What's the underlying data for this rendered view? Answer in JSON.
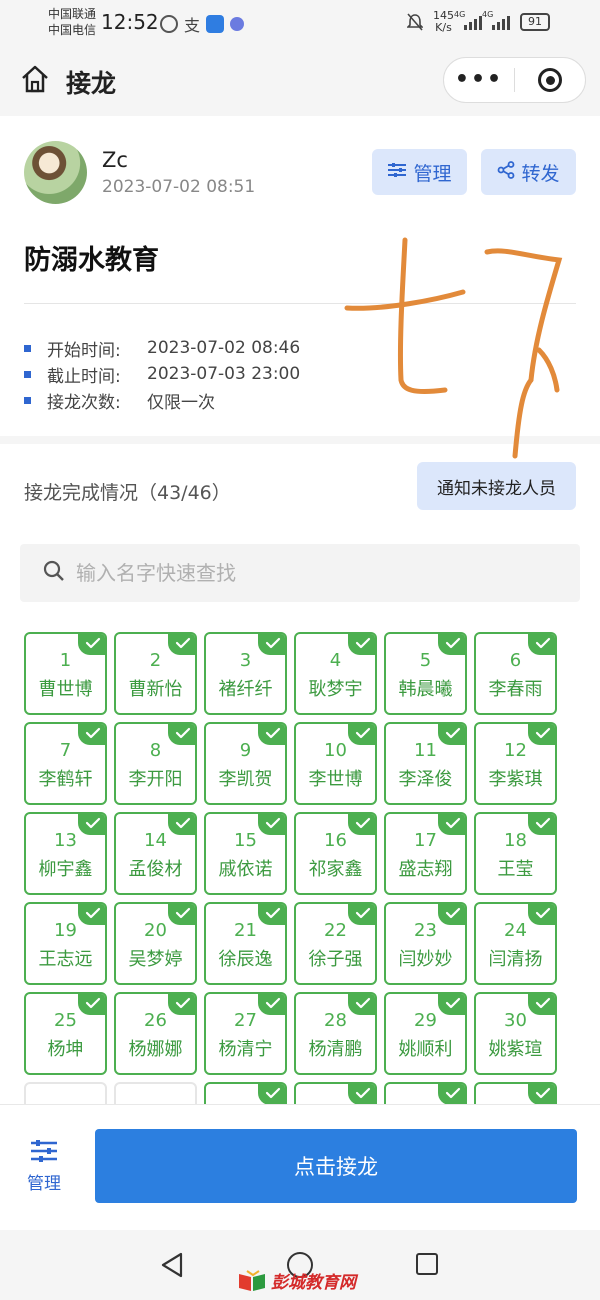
{
  "status_bar": {
    "carrier1": "中国联通",
    "carrier2": "中国电信",
    "time": "12:52",
    "speed_value": "145",
    "speed_unit": "K/s",
    "net1": "4G",
    "net2": "4G",
    "battery": "91"
  },
  "title_bar": {
    "title": "接龙",
    "more_label": "•••"
  },
  "post": {
    "author": "Zc",
    "date": "2023-07-02 08:51",
    "manage_label": "管理",
    "share_label": "转发",
    "title": "防溺水教育",
    "meta": [
      {
        "label": "开始时间:",
        "value": "2023-07-02 08:46"
      },
      {
        "label": "截止时间:",
        "value": "2023-07-03 23:00"
      },
      {
        "label": "接龙次数:",
        "value": "仅限一次"
      }
    ]
  },
  "progress": {
    "title": "接龙完成情况（43/46）",
    "notify_label": "通知未接龙人员",
    "search_placeholder": "输入名字快速查找",
    "entries": [
      {
        "num": "1",
        "name": "曹世博"
      },
      {
        "num": "2",
        "name": "曹新怡"
      },
      {
        "num": "3",
        "name": "褚纤纤"
      },
      {
        "num": "4",
        "name": "耿梦宇"
      },
      {
        "num": "5",
        "name": "韩晨曦"
      },
      {
        "num": "6",
        "name": "李春雨"
      },
      {
        "num": "7",
        "name": "李鹤轩"
      },
      {
        "num": "8",
        "name": "李开阳"
      },
      {
        "num": "9",
        "name": "李凯贺"
      },
      {
        "num": "10",
        "name": "李世博"
      },
      {
        "num": "11",
        "name": "李泽俊"
      },
      {
        "num": "12",
        "name": "李紫琪"
      },
      {
        "num": "13",
        "name": "柳宇鑫"
      },
      {
        "num": "14",
        "name": "孟俊材"
      },
      {
        "num": "15",
        "name": "戚依诺"
      },
      {
        "num": "16",
        "name": "祁家鑫"
      },
      {
        "num": "17",
        "name": "盛志翔"
      },
      {
        "num": "18",
        "name": "王莹"
      },
      {
        "num": "19",
        "name": "王志远"
      },
      {
        "num": "20",
        "name": "吴梦婷"
      },
      {
        "num": "21",
        "name": "徐辰逸"
      },
      {
        "num": "22",
        "name": "徐子强"
      },
      {
        "num": "23",
        "name": "闫妙妙"
      },
      {
        "num": "24",
        "name": "闫清扬"
      },
      {
        "num": "25",
        "name": "杨坤"
      },
      {
        "num": "26",
        "name": "杨娜娜"
      },
      {
        "num": "27",
        "name": "杨清宁"
      },
      {
        "num": "28",
        "name": "杨清鹏"
      },
      {
        "num": "29",
        "name": "姚顺利"
      },
      {
        "num": "30",
        "name": "姚紫瑄"
      }
    ]
  },
  "bottom": {
    "manage_label": "管理",
    "action_label": "点击接龙"
  },
  "watermark": "彭城教育网",
  "colors": {
    "accent_blue": "#2c7fe0",
    "done_green": "#4caf50",
    "light_blue_bg": "#dce7fb"
  }
}
